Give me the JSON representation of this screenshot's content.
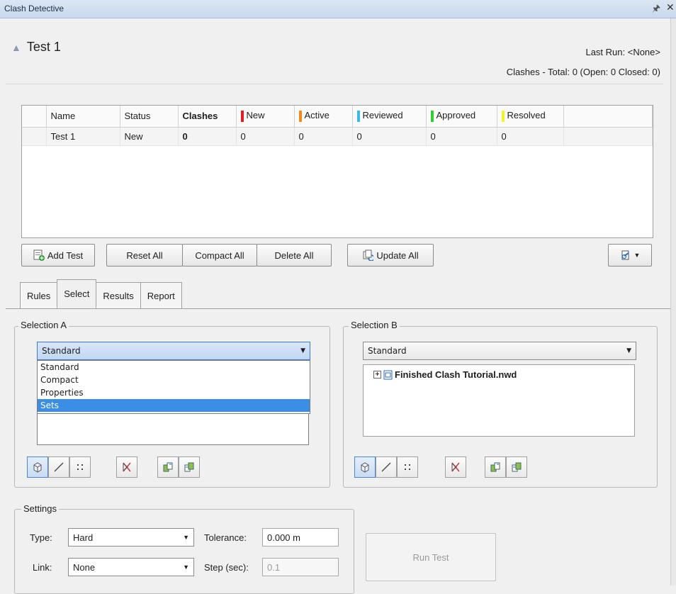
{
  "window": {
    "title": "Clash Detective"
  },
  "test": {
    "name": "Test 1",
    "last_run": "Last Run: <None>",
    "totals": "Clashes - Total: 0 (Open: 0 Closed: 0)"
  },
  "grid": {
    "headers": [
      "Name",
      "Status",
      "Clashes",
      "New",
      "Active",
      "Reviewed",
      "Approved",
      "Resolved"
    ],
    "status_colors": {
      "New": "#e02020",
      "Active": "#f08a1c",
      "Reviewed": "#3bb9e8",
      "Approved": "#33cc33",
      "Resolved": "#f2f22c"
    },
    "rows": [
      {
        "name": "Test 1",
        "status": "New",
        "clashes": "0",
        "new": "0",
        "active": "0",
        "reviewed": "0",
        "approved": "0",
        "resolved": "0"
      }
    ]
  },
  "toolbar": {
    "add_test": "Add Test",
    "reset_all": "Reset All",
    "compact_all": "Compact All",
    "delete_all": "Delete All",
    "update_all": "Update All"
  },
  "tabs": [
    "Rules",
    "Select",
    "Results",
    "Report"
  ],
  "active_tab": "Select",
  "selection_a": {
    "label": "Selection A",
    "dropdown_value": "Standard",
    "options": [
      "Standard",
      "Compact",
      "Properties",
      "Sets"
    ],
    "highlighted": "Sets"
  },
  "selection_b": {
    "label": "Selection B",
    "dropdown_value": "Standard",
    "tree_root": "Finished Clash Tutorial.nwd"
  },
  "settings": {
    "label": "Settings",
    "type_label": "Type:",
    "type_value": "Hard",
    "tolerance_label": "Tolerance:",
    "tolerance_value": "0.000 m",
    "link_label": "Link:",
    "link_value": "None",
    "step_label": "Step (sec):",
    "step_value": "0.1"
  },
  "run_test": "Run Test",
  "icons": [
    "pin-icon",
    "close-icon",
    "collapse-chevron-icon",
    "add-test-icon",
    "update-all-icon",
    "export-icon",
    "surfaces-icon",
    "lines-icon",
    "points-icon",
    "self-intersect-icon",
    "use-current-selection-icon",
    "select-in-scene-icon",
    "expand-plus-icon",
    "file-icon"
  ]
}
